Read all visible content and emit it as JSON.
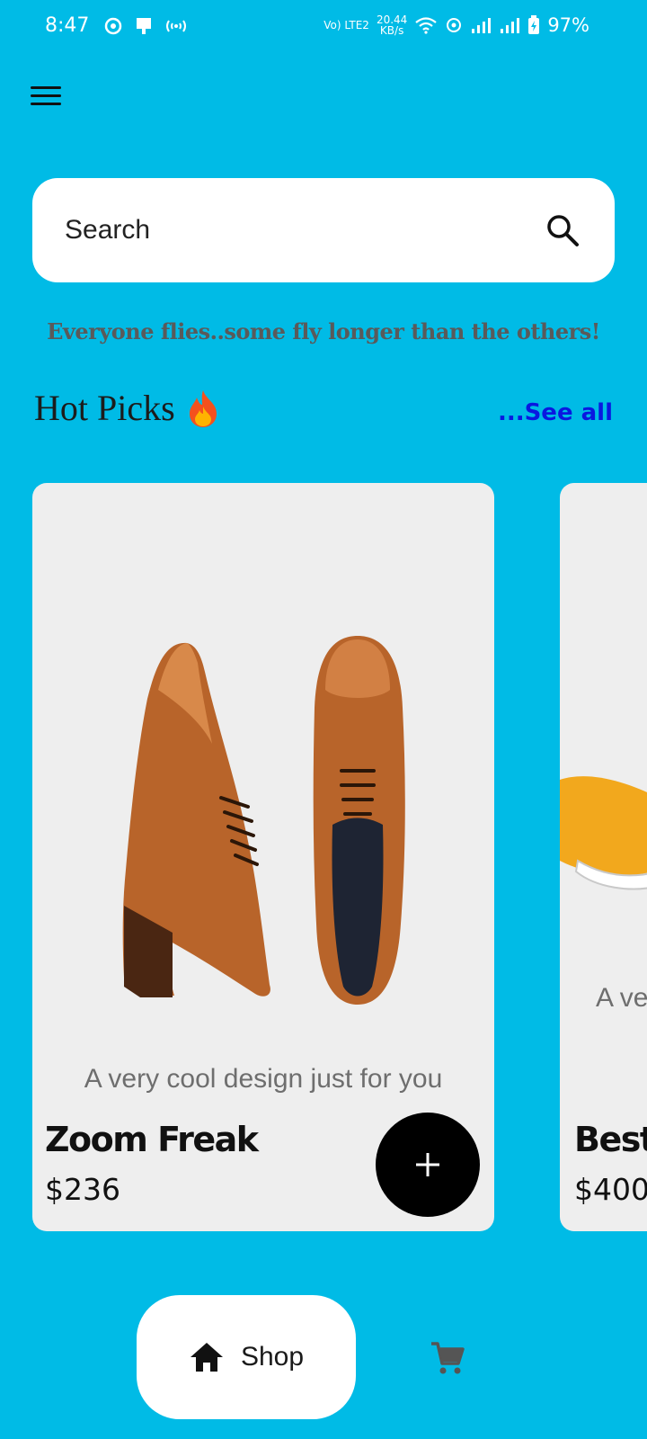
{
  "status_bar": {
    "time": "8:47",
    "net_speed_value": "20.44",
    "net_speed_unit": "KB/s",
    "lte_label": "Vo) LTE2",
    "battery": "97%",
    "icons": [
      "whatsapp-icon",
      "notification-icon",
      "hotspot-icon",
      "wifi-icon",
      "signal-icon",
      "signal-icon",
      "battery-charging-icon"
    ]
  },
  "header": {
    "menu_icon": "hamburger-menu-icon"
  },
  "search": {
    "placeholder": "Search",
    "icon": "search-icon"
  },
  "tagline": "Everyone flies..some fly longer than the others!",
  "section": {
    "title": "Hot Picks",
    "icon": "fire-icon",
    "see_all": "...See all"
  },
  "products": [
    {
      "description": "A very cool design just for you",
      "name": "Zoom Freak",
      "price": "$236",
      "add_icon": "plus-icon"
    },
    {
      "description": "A ve",
      "name": "Best",
      "price": "$400"
    }
  ],
  "bottom_nav": {
    "shop_label": "Shop",
    "shop_icon": "home-icon",
    "cart_icon": "cart-icon"
  },
  "colors": {
    "background": "#00BBE6",
    "card": "#EEEEEE",
    "see_all": "#0A18E0",
    "add_button": "#000000"
  }
}
